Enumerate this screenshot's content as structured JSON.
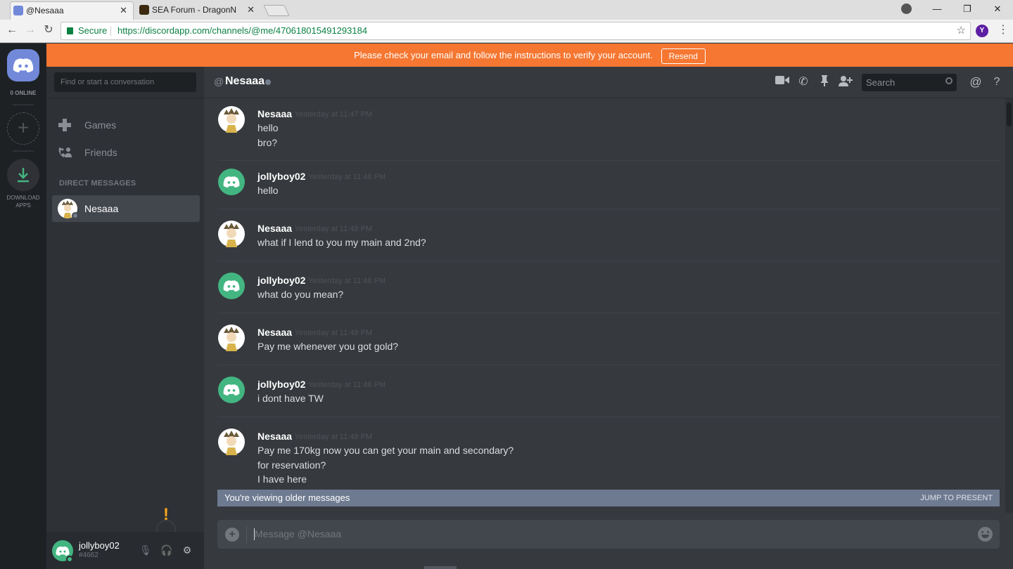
{
  "browser": {
    "tabs": [
      {
        "title": "@Nesaaa",
        "active": true
      },
      {
        "title": "SEA Forum - DragonNest",
        "active": false
      }
    ],
    "secure_label": "Secure",
    "url": "https://discordapp.com/channels/@me/470618015491293184",
    "profile_initial": "Y"
  },
  "banner": {
    "text": "Please check your email and follow the instructions to verify your account.",
    "button": "Resend"
  },
  "guilds": {
    "online_count": "0 ONLINE",
    "download_label_1": "DOWNLOAD",
    "download_label_2": "APPS"
  },
  "sidebar": {
    "search_placeholder": "Find or start a conversation",
    "nav": [
      {
        "label": "Games",
        "icon": "gamepad-icon"
      },
      {
        "label": "Friends",
        "icon": "friends-icon"
      }
    ],
    "dm_header": "DIRECT MESSAGES",
    "dms": [
      {
        "name": "Nesaaa",
        "status": "offline"
      }
    ]
  },
  "user": {
    "name": "jollyboy02",
    "tag": "#4662"
  },
  "chat": {
    "at": "@",
    "title": "Nesaaa",
    "search_placeholder": "Search",
    "messages": [
      {
        "author": "Nesaaa",
        "time": "Yesterday at 11:47 PM",
        "lines": [
          "hello",
          "bro?"
        ]
      },
      {
        "author": "jollyboy02",
        "time": "Yesterday at 11:48 PM",
        "lines": [
          "hello"
        ]
      },
      {
        "author": "Nesaaa",
        "time": "Yesterday at 11:48 PM",
        "lines": [
          "what if I lend to you my main and 2nd?"
        ]
      },
      {
        "author": "jollyboy02",
        "time": "Yesterday at 11:48 PM",
        "lines": [
          "what do you mean?"
        ]
      },
      {
        "author": "Nesaaa",
        "time": "Yesterday at 11:48 PM",
        "lines": [
          "Pay me whenever you got gold?"
        ]
      },
      {
        "author": "jollyboy02",
        "time": "Yesterday at 11:48 PM",
        "lines": [
          "i dont have TW"
        ]
      },
      {
        "author": "Nesaaa",
        "time": "Yesterday at 11:48 PM",
        "lines": [
          "Pay me 170kg now you can get your main and secondary?",
          "for reservation?",
          "I have here"
        ]
      }
    ],
    "older_notice": "You're viewing older messages",
    "jump_label": "JUMP TO PRESENT",
    "composer_placeholder": "Message @Nesaaa"
  },
  "colors": {
    "banner": "#f57731",
    "blurple": "#7289da",
    "green": "#43b581",
    "bg_chat": "#36393e",
    "bg_sidebar": "#2e3136",
    "bg_guilds": "#1e2124"
  }
}
